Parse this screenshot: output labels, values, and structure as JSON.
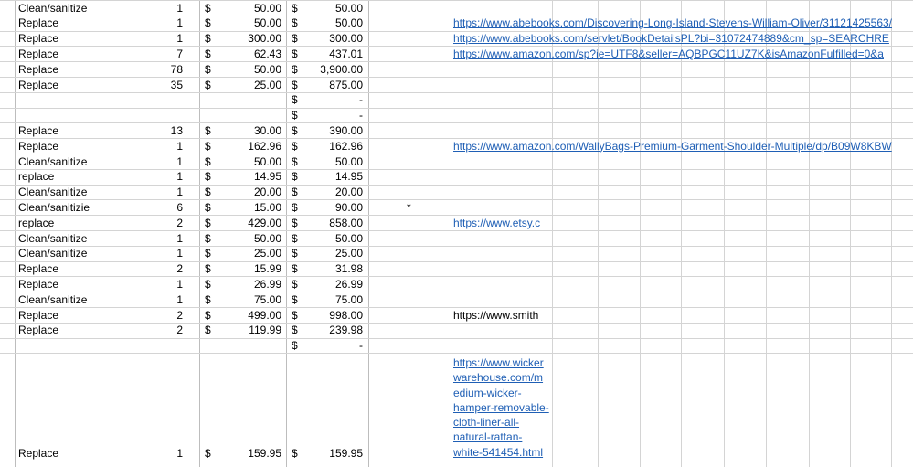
{
  "rows": [
    {
      "action": "Clean/sanitize",
      "qty": "1",
      "d1": "$",
      "price": "50.00",
      "d2": "$",
      "total": "50.00",
      "note": "",
      "link": ""
    },
    {
      "action": "Replace",
      "qty": "1",
      "d1": "$",
      "price": "50.00",
      "d2": "$",
      "total": "50.00",
      "note": "",
      "link": "https://www.abebooks.com/Discovering-Long-Island-Stevens-William-Oliver/31121425563/"
    },
    {
      "action": "Replace",
      "qty": "1",
      "d1": "$",
      "price": "300.00",
      "d2": "$",
      "total": "300.00",
      "note": "",
      "link": "https://www.abebooks.com/servlet/BookDetailsPL?bi=31072474889&cm_sp=SEARCHRE"
    },
    {
      "action": "Replace",
      "qty": "7",
      "d1": "$",
      "price": "62.43",
      "d2": "$",
      "total": "437.01",
      "note": "",
      "link": "https://www.amazon.com/sp?ie=UTF8&seller=AQBPGC11UZ7K&isAmazonFulfilled=0&a"
    },
    {
      "action": "Replace",
      "qty": "78",
      "d1": "$",
      "price": "50.00",
      "d2": "$",
      "total": "3,900.00",
      "note": "",
      "link": ""
    },
    {
      "action": "Replace",
      "qty": "35",
      "d1": "$",
      "price": "25.00",
      "d2": "$",
      "total": "875.00",
      "note": "",
      "link": ""
    },
    {
      "action": "",
      "qty": "",
      "d1": "",
      "price": "",
      "d2": "$",
      "total": "-",
      "note": "",
      "link": ""
    },
    {
      "action": "",
      "qty": "",
      "d1": "",
      "price": "",
      "d2": "$",
      "total": "-",
      "note": "",
      "link": ""
    },
    {
      "action": "Replace",
      "qty": "13",
      "d1": "$",
      "price": "30.00",
      "d2": "$",
      "total": "390.00",
      "note": "",
      "link": ""
    },
    {
      "action": "Replace",
      "qty": "1",
      "d1": "$",
      "price": "162.96",
      "d2": "$",
      "total": "162.96",
      "note": "",
      "link": "https://www.amazon.com/WallyBags-Premium-Garment-Shoulder-Multiple/dp/B09W8KBW"
    },
    {
      "action": "Clean/sanitize",
      "qty": "1",
      "d1": "$",
      "price": "50.00",
      "d2": "$",
      "total": "50.00",
      "note": "",
      "link": ""
    },
    {
      "action": "replace",
      "qty": "1",
      "d1": "$",
      "price": "14.95",
      "d2": "$",
      "total": "14.95",
      "note": "",
      "link": ""
    },
    {
      "action": "Clean/sanitize",
      "qty": "1",
      "d1": "$",
      "price": "20.00",
      "d2": "$",
      "total": "20.00",
      "note": "",
      "link": ""
    },
    {
      "action": "Clean/sanitizie",
      "qty": "6",
      "d1": "$",
      "price": "15.00",
      "d2": "$",
      "total": "90.00",
      "note": "*",
      "link": ""
    },
    {
      "action": "replace",
      "qty": "2",
      "d1": "$",
      "price": "429.00",
      "d2": "$",
      "total": "858.00",
      "note": "",
      "link": "https://www.etsy.c"
    },
    {
      "action": "Clean/sanitize",
      "qty": "1",
      "d1": "$",
      "price": "50.00",
      "d2": "$",
      "total": "50.00",
      "note": "",
      "link": ""
    },
    {
      "action": "Clean/sanitize",
      "qty": "1",
      "d1": "$",
      "price": "25.00",
      "d2": "$",
      "total": "25.00",
      "note": "",
      "link": ""
    },
    {
      "action": "Replace",
      "qty": "2",
      "d1": "$",
      "price": "15.99",
      "d2": "$",
      "total": "31.98",
      "note": "",
      "link": ""
    },
    {
      "action": "Replace",
      "qty": "1",
      "d1": "$",
      "price": "26.99",
      "d2": "$",
      "total": "26.99",
      "note": "",
      "link": ""
    },
    {
      "action": "Clean/sanitize",
      "qty": "1",
      "d1": "$",
      "price": "75.00",
      "d2": "$",
      "total": "75.00",
      "note": "",
      "link": ""
    },
    {
      "action": "Replace",
      "qty": "2",
      "d1": "$",
      "price": "499.00",
      "d2": "$",
      "total": "998.00",
      "note": "",
      "link": "",
      "plain": "https://www.smith"
    },
    {
      "action": "Replace",
      "qty": "2",
      "d1": "$",
      "price": "119.99",
      "d2": "$",
      "total": "239.98",
      "note": "",
      "link": ""
    },
    {
      "action": "",
      "qty": "",
      "d1": "",
      "price": "",
      "d2": "$",
      "total": "-",
      "note": "",
      "link": ""
    }
  ],
  "tall_row": {
    "action": "Replace",
    "qty": "1",
    "d1": "$",
    "price": "159.95",
    "d2": "$",
    "total": "159.95",
    "link_lines": [
      "https://www.wicker",
      "warehouse.com/m",
      "edium-wicker-",
      "hamper-removable-",
      "cloth-liner-all-",
      "natural-rattan-",
      "white-541454.html"
    ]
  }
}
